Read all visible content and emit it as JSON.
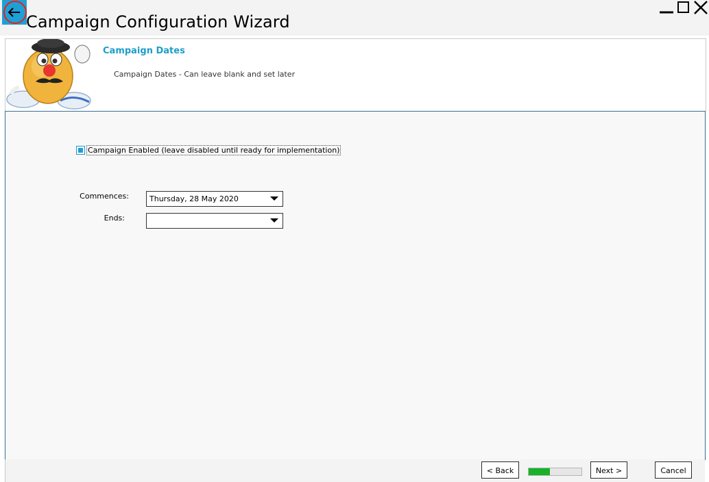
{
  "window": {
    "title": "Campaign Configuration Wizard",
    "controls": [
      "minimize-icon",
      "maximize-icon",
      "close-icon"
    ]
  },
  "header": {
    "title": "Campaign Dates",
    "subtitle": "Campaign Dates - Can leave blank and set later"
  },
  "form": {
    "campaign_enabled": {
      "label": "Campaign Enabled (leave disabled until ready for implementation)",
      "checked": true
    },
    "commences": {
      "label": "Commences:",
      "value": "Thursday, 28 May 2020"
    },
    "ends": {
      "label": "Ends:",
      "value": ""
    }
  },
  "footer": {
    "back_label": "< Back",
    "next_label": "Next >",
    "cancel_label": "Cancel",
    "progress_fraction": 0.4
  },
  "colors": {
    "accent": "#1f9fd6",
    "header_title": "#1c9ec9",
    "progress": "#17b227",
    "back_ring": "#e0241a"
  }
}
